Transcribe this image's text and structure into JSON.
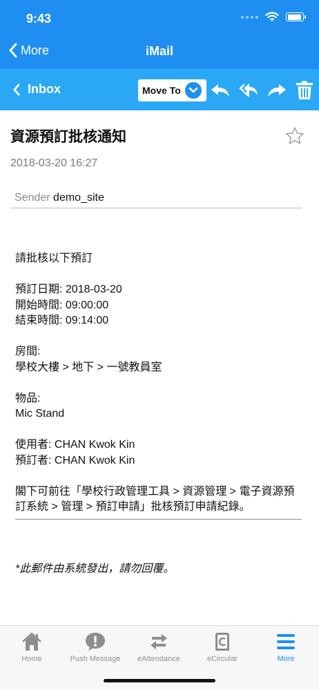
{
  "status_bar": {
    "time": "9:43"
  },
  "nav": {
    "back_label": "More",
    "title": "iMail"
  },
  "toolbar": {
    "inbox_label": "Inbox",
    "move_to_label": "Move To"
  },
  "mail": {
    "subject": "資源預訂批核通知",
    "date": "2018-03-20 16:27",
    "sender_label": "Sender",
    "sender_value": "demo_site",
    "body": {
      "intro": "請批核以下預訂",
      "booking_date": "預訂日期: 2018-03-20",
      "start_time": "開始時間: 09:00:00",
      "end_time": "結束時間: 09:14:00",
      "room_label": "房間:",
      "room_value": "學校大樓 > 地下 > 一號教員室",
      "item_label": "物品:",
      "item_value": "Mic Stand",
      "user": "使用者: CHAN Kwok Kin",
      "booker": "預訂者: CHAN Kwok Kin",
      "instruction": "閣下可前往「學校行政管理工具 > 資源管理 > 電子資源預訂系統 > 管理 > 預訂申請」批核預訂申請紀錄。"
    },
    "footer_note": "*此郵件由系統發出，請勿回覆。"
  },
  "tabs": [
    {
      "label": "Home",
      "icon": "home-icon",
      "active": false
    },
    {
      "label": "Push Message",
      "icon": "push-message-icon",
      "active": false
    },
    {
      "label": "eAttendance",
      "icon": "attendance-arrows-icon",
      "active": false
    },
    {
      "label": "eCircular",
      "icon": "ecircular-icon",
      "active": false
    },
    {
      "label": "More",
      "icon": "menu-icon",
      "active": true
    }
  ],
  "colors": {
    "nav_blue": "#1e8ff0",
    "toolbar_blue": "#2aa8f6",
    "tab_inactive": "#8e8e8e"
  }
}
